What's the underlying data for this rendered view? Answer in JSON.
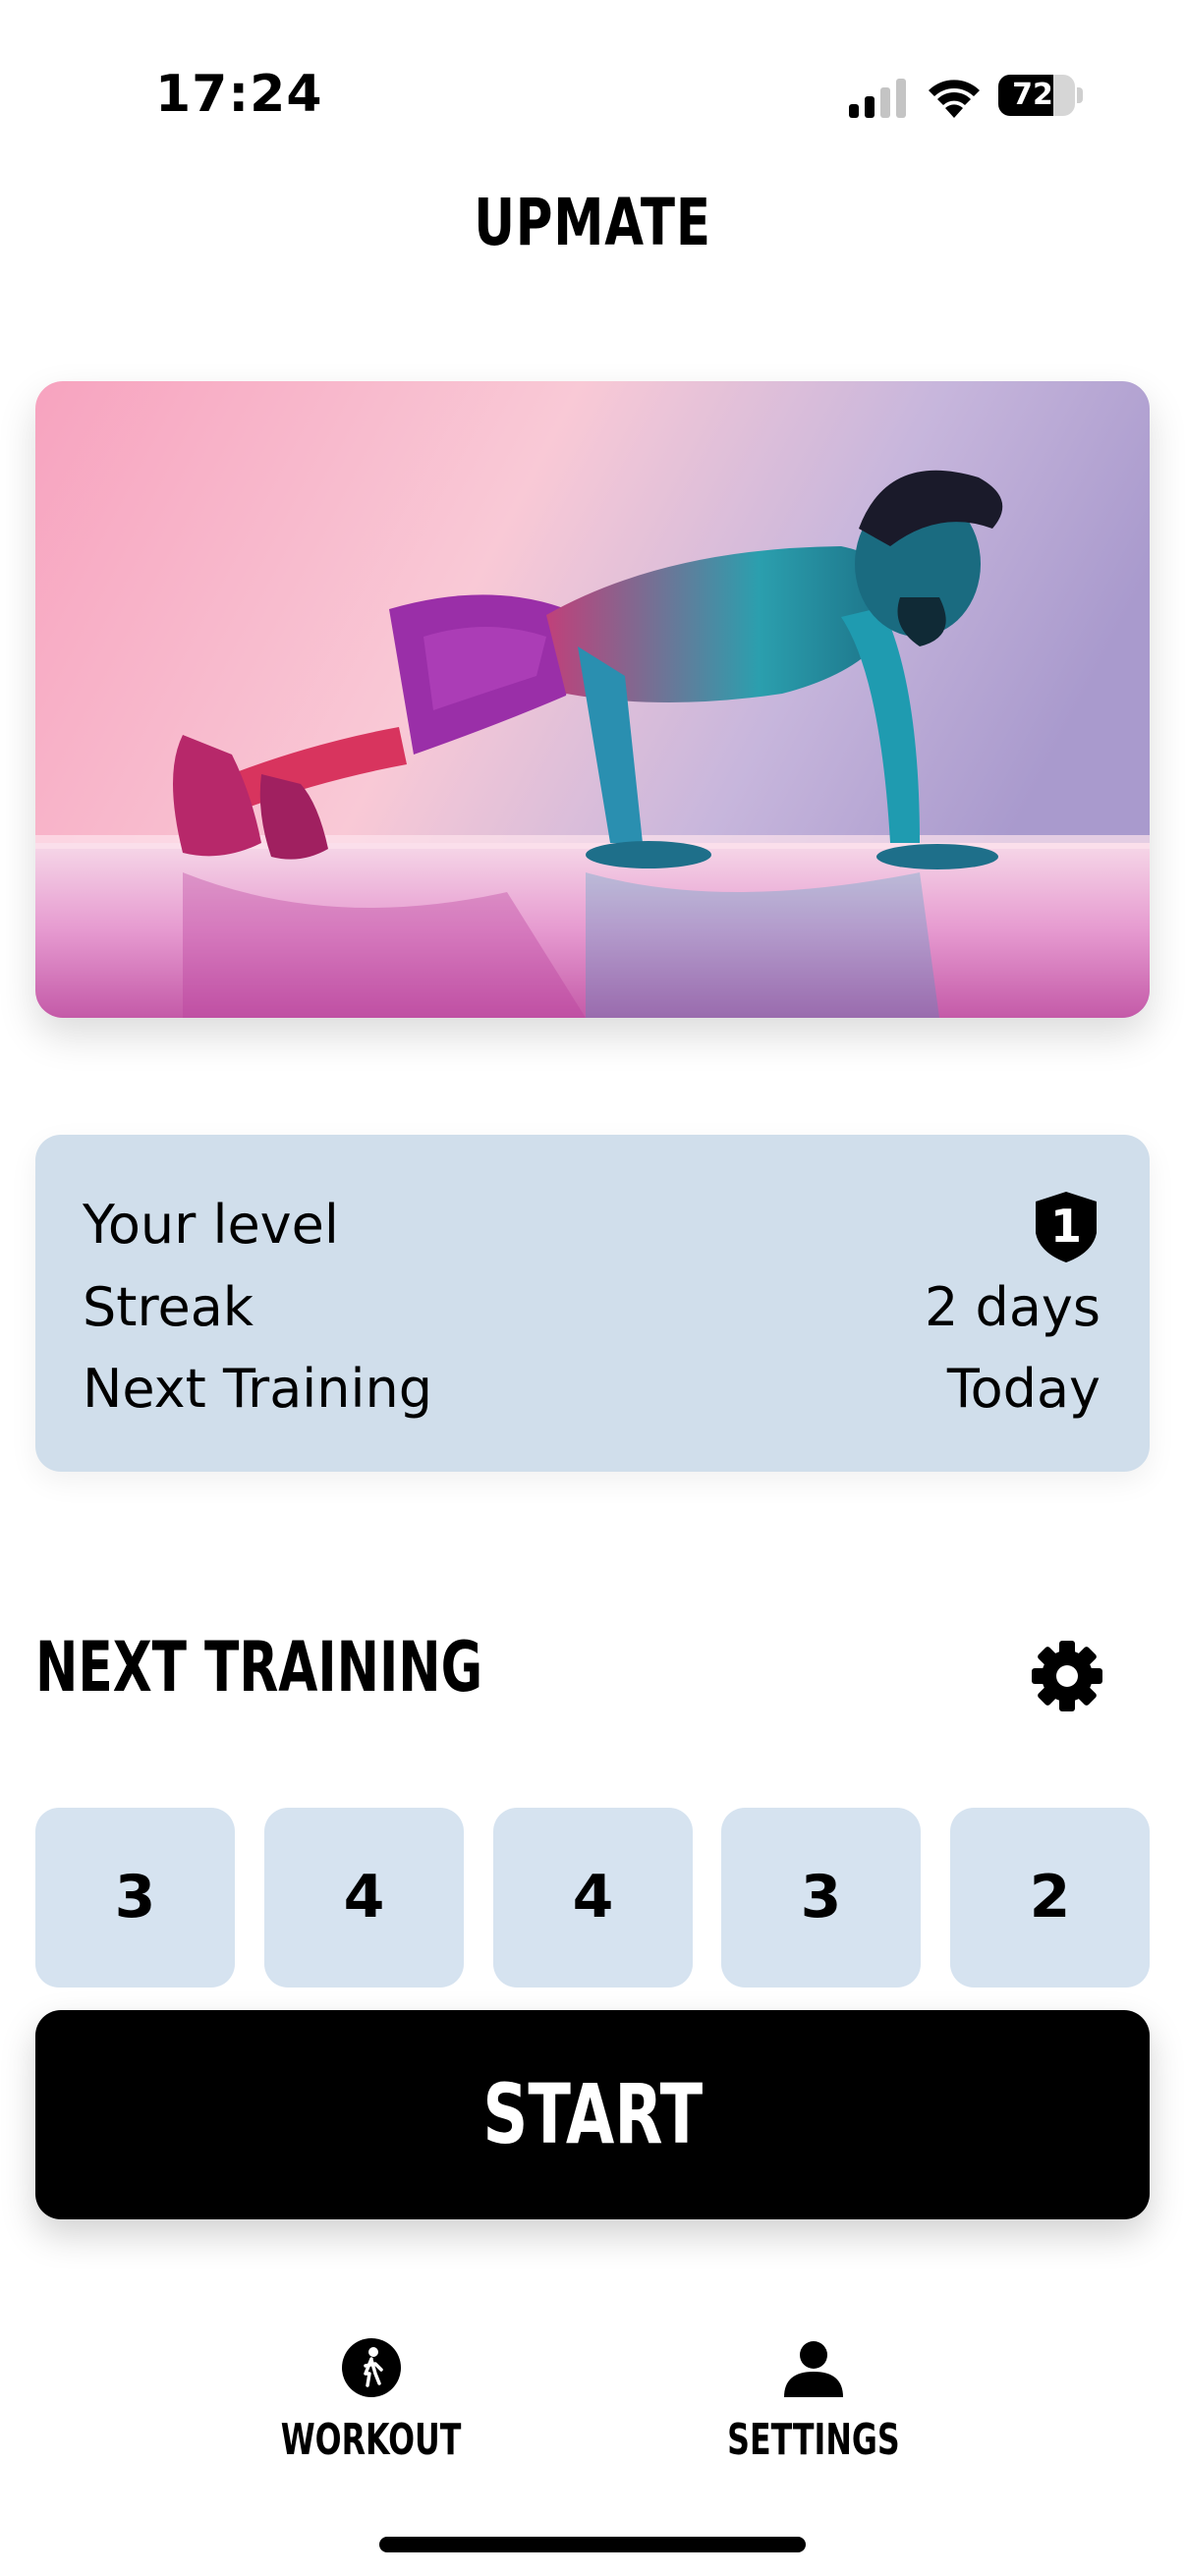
{
  "status_bar": {
    "time": "17:24",
    "battery": "72",
    "battery_level": 0.72
  },
  "app": {
    "title": "UPMATE"
  },
  "hero": {
    "image": "man-doing-pushup-photo"
  },
  "stats": {
    "level_label": "Your level",
    "level_value": "1",
    "streak_label": "Streak",
    "streak_value": "2 days",
    "next_label": "Next Training",
    "next_value": "Today"
  },
  "next_training": {
    "title": "NEXT TRAINING",
    "sets": [
      "3",
      "4",
      "4",
      "3",
      "2"
    ]
  },
  "start_button": {
    "label": "START"
  },
  "tabbar": {
    "workout": {
      "label": "WORKOUT",
      "icon": "walking-person-icon"
    },
    "settings": {
      "label": "SETTINGS",
      "icon": "person-icon"
    }
  },
  "colors": {
    "card_bg": "#d0deeb",
    "set_bg": "#d6e3f0",
    "button_bg": "#000000"
  }
}
